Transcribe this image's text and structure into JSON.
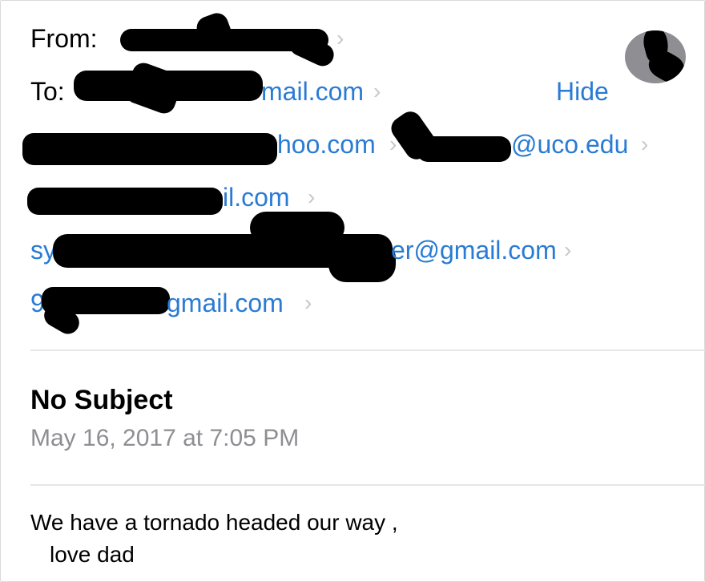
{
  "header": {
    "from_label": "From:",
    "from_chevron": "›",
    "to_label": "To:",
    "hide_label": "Hide",
    "recipients": [
      {
        "visible_text": "mail.com",
        "chevron": "›"
      },
      {
        "visible_text": "hoo.com",
        "chevron": "›"
      },
      {
        "visible_text": "@uco.edu",
        "chevron": "›"
      },
      {
        "visible_text": "il.com",
        "chevron": "›"
      },
      {
        "prefix": "sy",
        "visible_text": "er@gmail.com",
        "chevron": "›"
      },
      {
        "prefix": "9",
        "visible_text": "gmail.com",
        "chevron": "›"
      }
    ]
  },
  "message": {
    "subject": "No Subject",
    "date": "May 16, 2017 at 7:05 PM",
    "body_line1": "We have a tornado headed our way ,",
    "body_line2": "love dad"
  },
  "colors": {
    "link": "#2a7bd3",
    "date_gray": "#8e8e93",
    "chevron_gray": "#c7c7cc",
    "redaction": "#000000"
  },
  "icons": {
    "avatar": "contact-avatar-icon",
    "chevron": "chevron-right-icon"
  }
}
